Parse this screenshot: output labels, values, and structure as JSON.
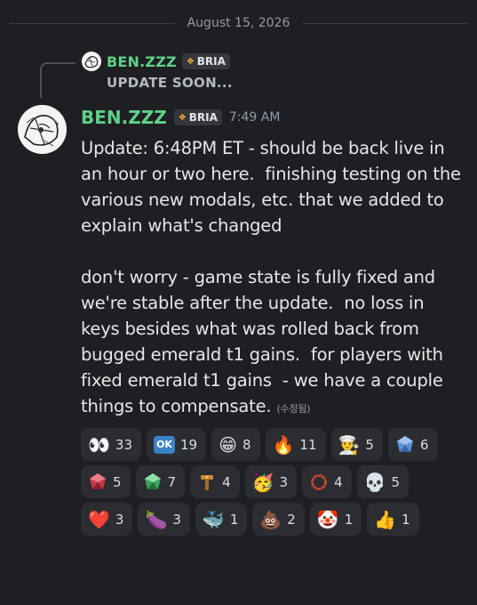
{
  "divider": {
    "date": "August 15, 2026"
  },
  "reply": {
    "username": "BEN.ZZZ",
    "tag": "BRIA",
    "text": "UPDATE SOON..."
  },
  "message": {
    "username": "BEN.ZZZ",
    "tag": "BRIA",
    "timestamp": "7:49 AM",
    "body": "Update: 6:48PM ET - should be back live in\nan hour or two here.  finishing testing on the\nvarious new modals, etc. that we added to\nexplain what's changed\n\ndon't worry - game state is fully fixed and\nwe're stable after the update.  no loss in\nkeys besides what was rolled back from\nbugged emerald t1 gains.  for players with\nfixed emerald t1 gains  - we have a couple\nthings to compensate.",
    "edited": "(수정됨)"
  },
  "reactions": [
    {
      "emoji": "👀",
      "count": "33"
    },
    {
      "emoji": "OK",
      "count": "19"
    },
    {
      "emoji": "😁",
      "count": "8"
    },
    {
      "emoji": "🔥",
      "count": "11"
    },
    {
      "emoji": "👨‍🍳",
      "count": "5"
    },
    {
      "emoji": "gem-blue",
      "count": "6"
    },
    {
      "emoji": "gem-red",
      "count": "5"
    },
    {
      "emoji": "gem-green",
      "count": "7"
    },
    {
      "emoji": "tool",
      "count": "4"
    },
    {
      "emoji": "🥳",
      "count": "3"
    },
    {
      "emoji": "ring",
      "count": "4"
    },
    {
      "emoji": "💀",
      "count": "5"
    },
    {
      "emoji": "❤️",
      "count": "3"
    },
    {
      "emoji": "🍆",
      "count": "3"
    },
    {
      "emoji": "🐳",
      "count": "1"
    },
    {
      "emoji": "💩",
      "count": "2"
    },
    {
      "emoji": "🤡",
      "count": "1"
    },
    {
      "emoji": "👍",
      "count": "1"
    }
  ],
  "colors": {
    "background": "#1e1f22",
    "username": "#60d088",
    "reaction_bg": "#2b2d31"
  }
}
